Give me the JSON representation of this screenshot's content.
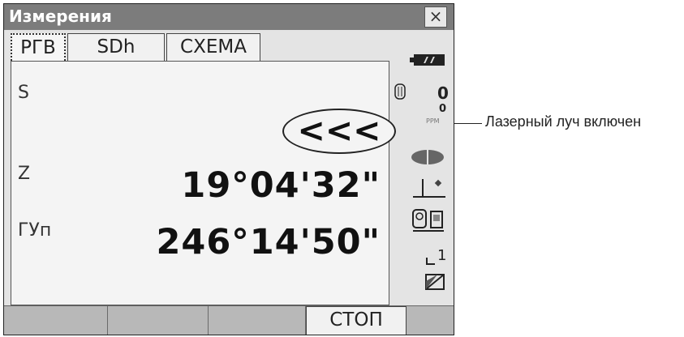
{
  "window": {
    "title": "Измерения",
    "close_glyph": "×"
  },
  "tabs": [
    {
      "label": "РГВ",
      "active": true
    },
    {
      "label": "SDh",
      "active": false
    },
    {
      "label": "СХЕМА",
      "active": false
    }
  ],
  "measurements": [
    {
      "label": "S",
      "value": "<<<"
    },
    {
      "label": "Z",
      "value": "19°04'32\""
    },
    {
      "label": "ГУп",
      "value": "246°14'50\""
    }
  ],
  "status": {
    "prism_constant": "0",
    "ppm": "0",
    "ppm_unit": "PPM",
    "channel": "1",
    "icons": [
      "battery-icon",
      "prism-icon",
      "laser-plummet-icon",
      "tilt-icon",
      "connection-icon",
      "channel-icon",
      "input-mode-icon"
    ]
  },
  "softkeys": [
    "",
    "",
    "",
    "СТОП",
    ""
  ],
  "annotation": {
    "text": "Лазерный луч включен"
  },
  "colors": {
    "titlebar": "#7c7c7c",
    "screen_bg": "#e4e4e4",
    "panel_bg": "#f4f4f4",
    "softkey_bar": "#b8b8b8"
  }
}
